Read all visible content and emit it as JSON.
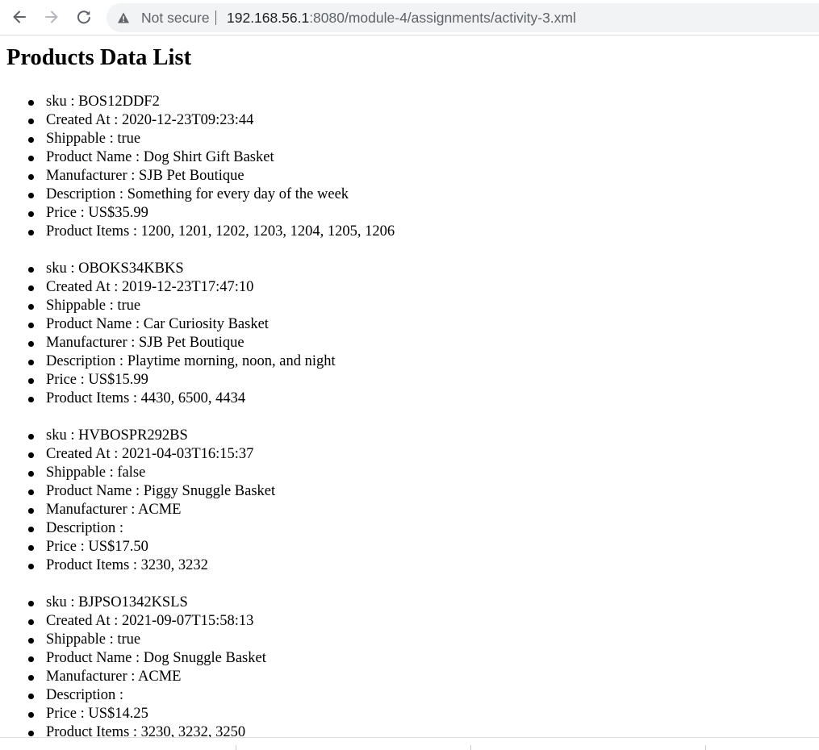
{
  "browser": {
    "security_label": "Not secure",
    "url_host": "192.168.56.1",
    "url_path": ":8080/module-4/assignments/activity-3.xml",
    "icons": {
      "back": "back-arrow-icon",
      "forward": "forward-arrow-icon",
      "reload": "reload-icon",
      "warning": "warning-triangle-icon"
    }
  },
  "page": {
    "title": "Products Data List"
  },
  "products": [
    {
      "sku": "sku : BOS12DDF2",
      "created_at": "Created At : 2020-12-23T09:23:44",
      "shippable": "Shippable : true",
      "name": "Product Name : Dog Shirt Gift Basket",
      "manufacturer": "Manufacturer : SJB Pet Boutique",
      "description": "Description : Something for every day of the week",
      "price": "Price : US$35.99",
      "items": "Product Items : 1200, 1201, 1202, 1203, 1204, 1205, 1206"
    },
    {
      "sku": "sku : OBOKS34KBKS",
      "created_at": "Created At : 2019-12-23T17:47:10",
      "shippable": "Shippable : true",
      "name": "Product Name : Car Curiosity Basket",
      "manufacturer": "Manufacturer : SJB Pet Boutique",
      "description": "Description : Playtime morning, noon, and night",
      "price": "Price : US$15.99",
      "items": "Product Items : 4430, 6500, 4434"
    },
    {
      "sku": "sku : HVBOSPR292BS",
      "created_at": "Created At : 2021-04-03T16:15:37",
      "shippable": "Shippable : false",
      "name": "Product Name : Piggy Snuggle Basket",
      "manufacturer": "Manufacturer : ACME",
      "description": "Description :",
      "price": "Price : US$17.50",
      "items": "Product Items : 3230, 3232"
    },
    {
      "sku": "sku : BJPSO1342KSLS",
      "created_at": "Created At : 2021-09-07T15:58:13",
      "shippable": "Shippable : true",
      "name": "Product Name : Dog Snuggle Basket",
      "manufacturer": "Manufacturer : ACME",
      "description": "Description :",
      "price": "Price : US$14.25",
      "items": "Product Items : 3230, 3232, 3250"
    }
  ]
}
